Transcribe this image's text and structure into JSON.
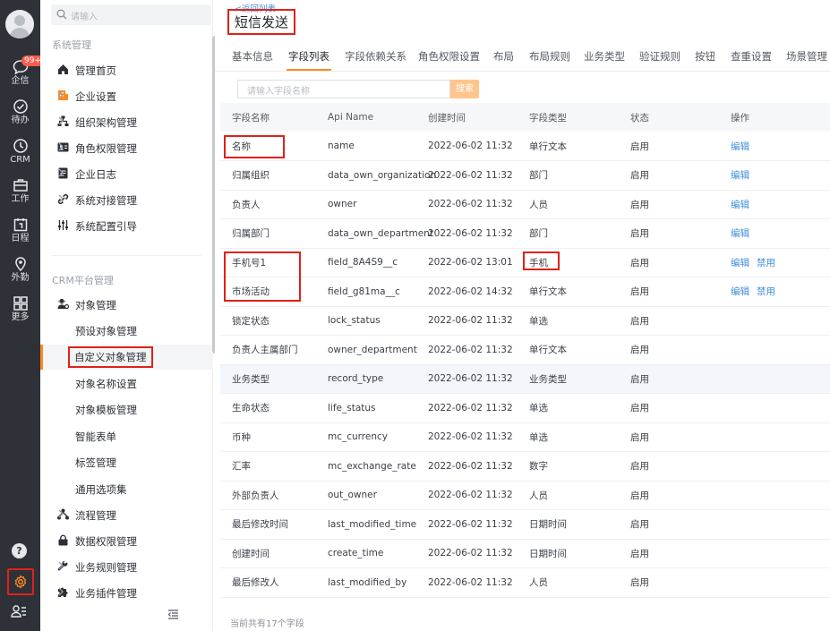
{
  "rail": {
    "badge": "99+",
    "items": [
      {
        "label": "企信",
        "icon": "chat-bubble-icon"
      },
      {
        "label": "待办",
        "icon": "check-circle-icon"
      },
      {
        "label": "CRM",
        "icon": "clock-icon"
      },
      {
        "label": "工作",
        "icon": "briefcase-icon"
      },
      {
        "label": "日程",
        "icon": "calendar-icon"
      },
      {
        "label": "外勤",
        "icon": "location-pin-icon"
      },
      {
        "label": "更多",
        "icon": "grid-icon"
      }
    ],
    "help": "?"
  },
  "nav": {
    "search_placeholder": "请输入",
    "section_system": "系统管理",
    "section_crm": "CRM平台管理",
    "items": [
      {
        "label": "管理首页"
      },
      {
        "label": "企业设置"
      },
      {
        "label": "组织架构管理"
      },
      {
        "label": "角色权限管理"
      },
      {
        "label": "企业日志"
      },
      {
        "label": "系统对接管理"
      },
      {
        "label": "系统配置引导"
      }
    ],
    "object_mgmt": "对象管理",
    "sub_items": [
      {
        "label": "预设对象管理"
      },
      {
        "label": "自定义对象管理"
      },
      {
        "label": "对象名称设置"
      },
      {
        "label": "对象模板管理"
      },
      {
        "label": "智能表单"
      },
      {
        "label": "标签管理"
      },
      {
        "label": "通用选项集"
      }
    ],
    "items_bottom": [
      {
        "label": "流程管理"
      },
      {
        "label": "数据权限管理"
      },
      {
        "label": "业务规则管理"
      },
      {
        "label": "业务插件管理"
      }
    ]
  },
  "main": {
    "back": "<返回列表",
    "title": "短信发送",
    "tabs": [
      {
        "label": "基本信息"
      },
      {
        "label": "字段列表"
      },
      {
        "label": "字段依赖关系"
      },
      {
        "label": "角色权限设置"
      },
      {
        "label": "布局"
      },
      {
        "label": "布局规则"
      },
      {
        "label": "业务类型"
      },
      {
        "label": "验证规则"
      },
      {
        "label": "按钮"
      },
      {
        "label": "查重设置"
      },
      {
        "label": "场景管理"
      }
    ],
    "search_placeholder": "请输入字段名称",
    "search_button": "搜索",
    "columns": [
      "字段名称",
      "Api Name",
      "创建时间",
      "字段类型",
      "状态",
      "操作"
    ],
    "rows": [
      {
        "name": "名称",
        "api": "name",
        "created": "2022-06-02 11:32",
        "type": "单行文本",
        "status": "启用",
        "actions": [
          "编辑"
        ]
      },
      {
        "name": "归属组织",
        "api": "data_own_organization",
        "created": "2022-06-02 11:32",
        "type": "部门",
        "status": "启用",
        "actions": [
          "编辑"
        ]
      },
      {
        "name": "负责人",
        "api": "owner",
        "created": "2022-06-02 11:32",
        "type": "人员",
        "status": "启用",
        "actions": [
          "编辑"
        ]
      },
      {
        "name": "归属部门",
        "api": "data_own_department",
        "created": "2022-06-02 11:32",
        "type": "部门",
        "status": "启用",
        "actions": [
          "编辑"
        ]
      },
      {
        "name": "手机号1",
        "api": "field_8A4S9__c",
        "created": "2022-06-02 13:01",
        "type": "手机",
        "status": "启用",
        "actions": [
          "编辑",
          "禁用"
        ]
      },
      {
        "name": "市场活动",
        "api": "field_g81ma__c",
        "created": "2022-06-02 14:32",
        "type": "单行文本",
        "status": "启用",
        "actions": [
          "编辑",
          "禁用"
        ]
      },
      {
        "name": "锁定状态",
        "api": "lock_status",
        "created": "2022-06-02 11:32",
        "type": "单选",
        "status": "启用",
        "actions": []
      },
      {
        "name": "负责人主属部门",
        "api": "owner_department",
        "created": "2022-06-02 11:32",
        "type": "单行文本",
        "status": "启用",
        "actions": []
      },
      {
        "name": "业务类型",
        "api": "record_type",
        "created": "2022-06-02 11:32",
        "type": "业务类型",
        "status": "启用",
        "actions": []
      },
      {
        "name": "生命状态",
        "api": "life_status",
        "created": "2022-06-02 11:32",
        "type": "单选",
        "status": "启用",
        "actions": []
      },
      {
        "name": "币种",
        "api": "mc_currency",
        "created": "2022-06-02 11:32",
        "type": "单选",
        "status": "启用",
        "actions": []
      },
      {
        "name": "汇率",
        "api": "mc_exchange_rate",
        "created": "2022-06-02 11:32",
        "type": "数字",
        "status": "启用",
        "actions": []
      },
      {
        "name": "外部负责人",
        "api": "out_owner",
        "created": "2022-06-02 11:32",
        "type": "人员",
        "status": "启用",
        "actions": []
      },
      {
        "name": "最后修改时间",
        "api": "last_modified_time",
        "created": "2022-06-02 11:32",
        "type": "日期时间",
        "status": "启用",
        "actions": []
      },
      {
        "name": "创建时间",
        "api": "create_time",
        "created": "2022-06-02 11:32",
        "type": "日期时间",
        "status": "启用",
        "actions": []
      },
      {
        "name": "最后修改人",
        "api": "last_modified_by",
        "created": "2022-06-02 11:32",
        "type": "人员",
        "status": "启用",
        "actions": []
      }
    ],
    "footer": "当前共有17个字段"
  },
  "colors": {
    "accent": "#ff8a1f",
    "link": "#3e8ed8",
    "rail": "#2e3138",
    "highlight_box": "#e0211b"
  }
}
